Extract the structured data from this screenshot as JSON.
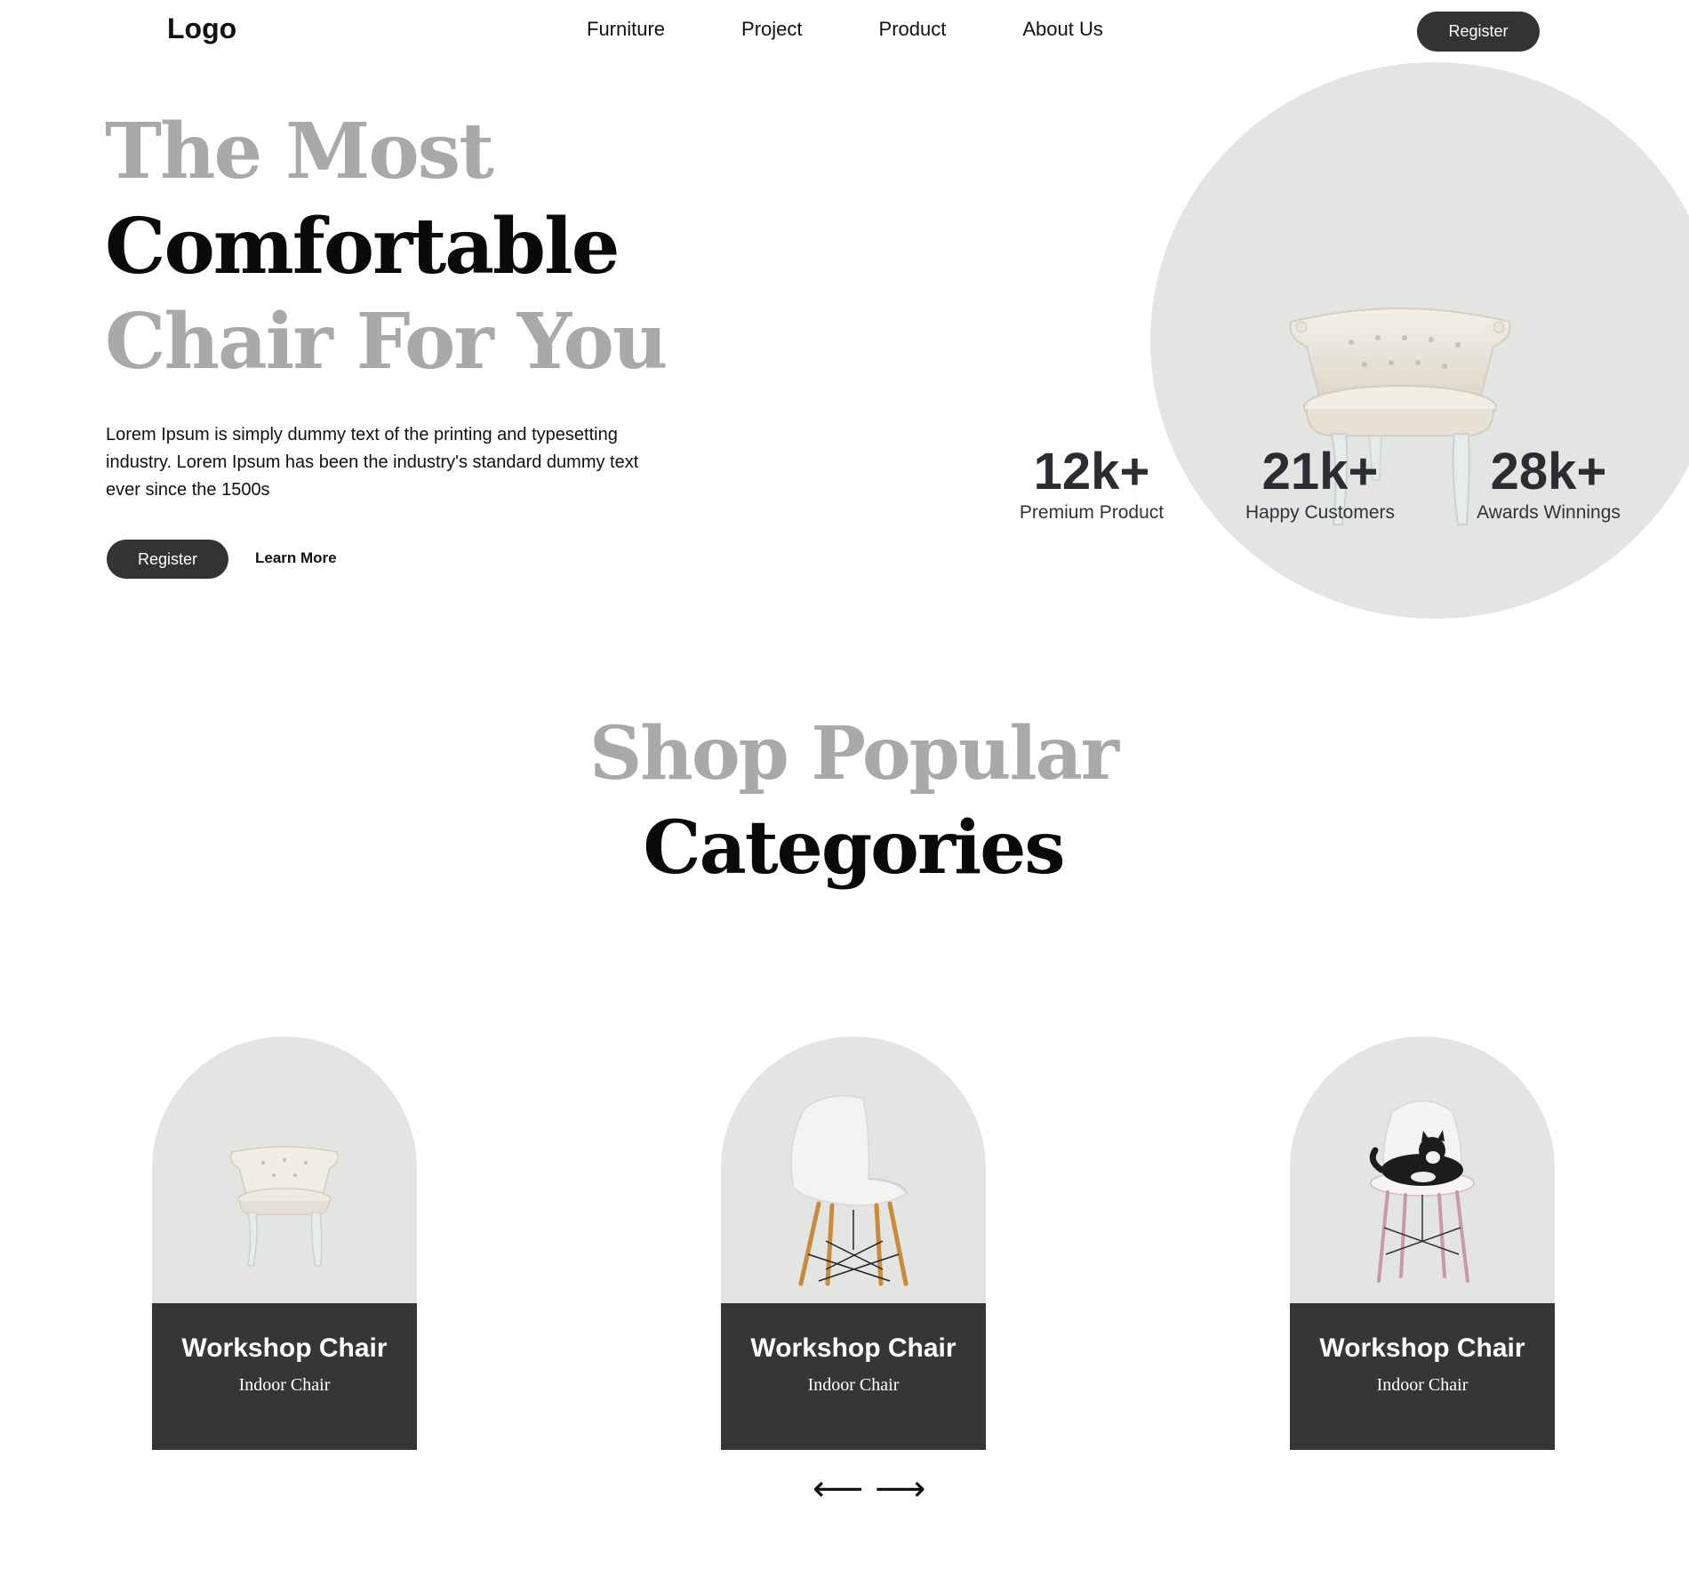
{
  "nav": {
    "logo": "Logo",
    "items": [
      {
        "label": "Furniture"
      },
      {
        "label": "Project"
      },
      {
        "label": "Product"
      },
      {
        "label": "About Us"
      }
    ],
    "register_label": "Register"
  },
  "hero": {
    "title_line1": "The Most",
    "title_line2": "Comfortable",
    "title_line3": "Chair For You",
    "description": "Lorem Ipsum is simply dummy text of the printing and typesetting industry. Lorem Ipsum has been the industry's standard dummy text ever since the 1500s",
    "register_label": "Register",
    "learn_more_label": "Learn More",
    "image_icon": "armchair-image"
  },
  "stats": [
    {
      "value": "12k+",
      "label": "Premium Product"
    },
    {
      "value": "21k+",
      "label": "Happy Customers"
    },
    {
      "value": "28k+",
      "label": "Awards Winnings"
    }
  ],
  "categories": {
    "title_line1": "Shop Popular",
    "title_line2": "Categories",
    "cards": [
      {
        "title": "Workshop Chair",
        "subtitle": "Indoor Chair",
        "image_icon": "tufted-armchair-image"
      },
      {
        "title": "Workshop Chair",
        "subtitle": "Indoor Chair",
        "image_icon": "white-shell-chair-image"
      },
      {
        "title": "Workshop Chair",
        "subtitle": "Indoor Chair",
        "image_icon": "chair-with-cat-image"
      }
    ],
    "prev_arrow": "⟵",
    "next_arrow": "⟶"
  },
  "colors": {
    "dark_button": "#333333",
    "circle_bg": "#e3e5e2",
    "muted_heading": "#a9a9a9",
    "card_footer": "#363636"
  }
}
